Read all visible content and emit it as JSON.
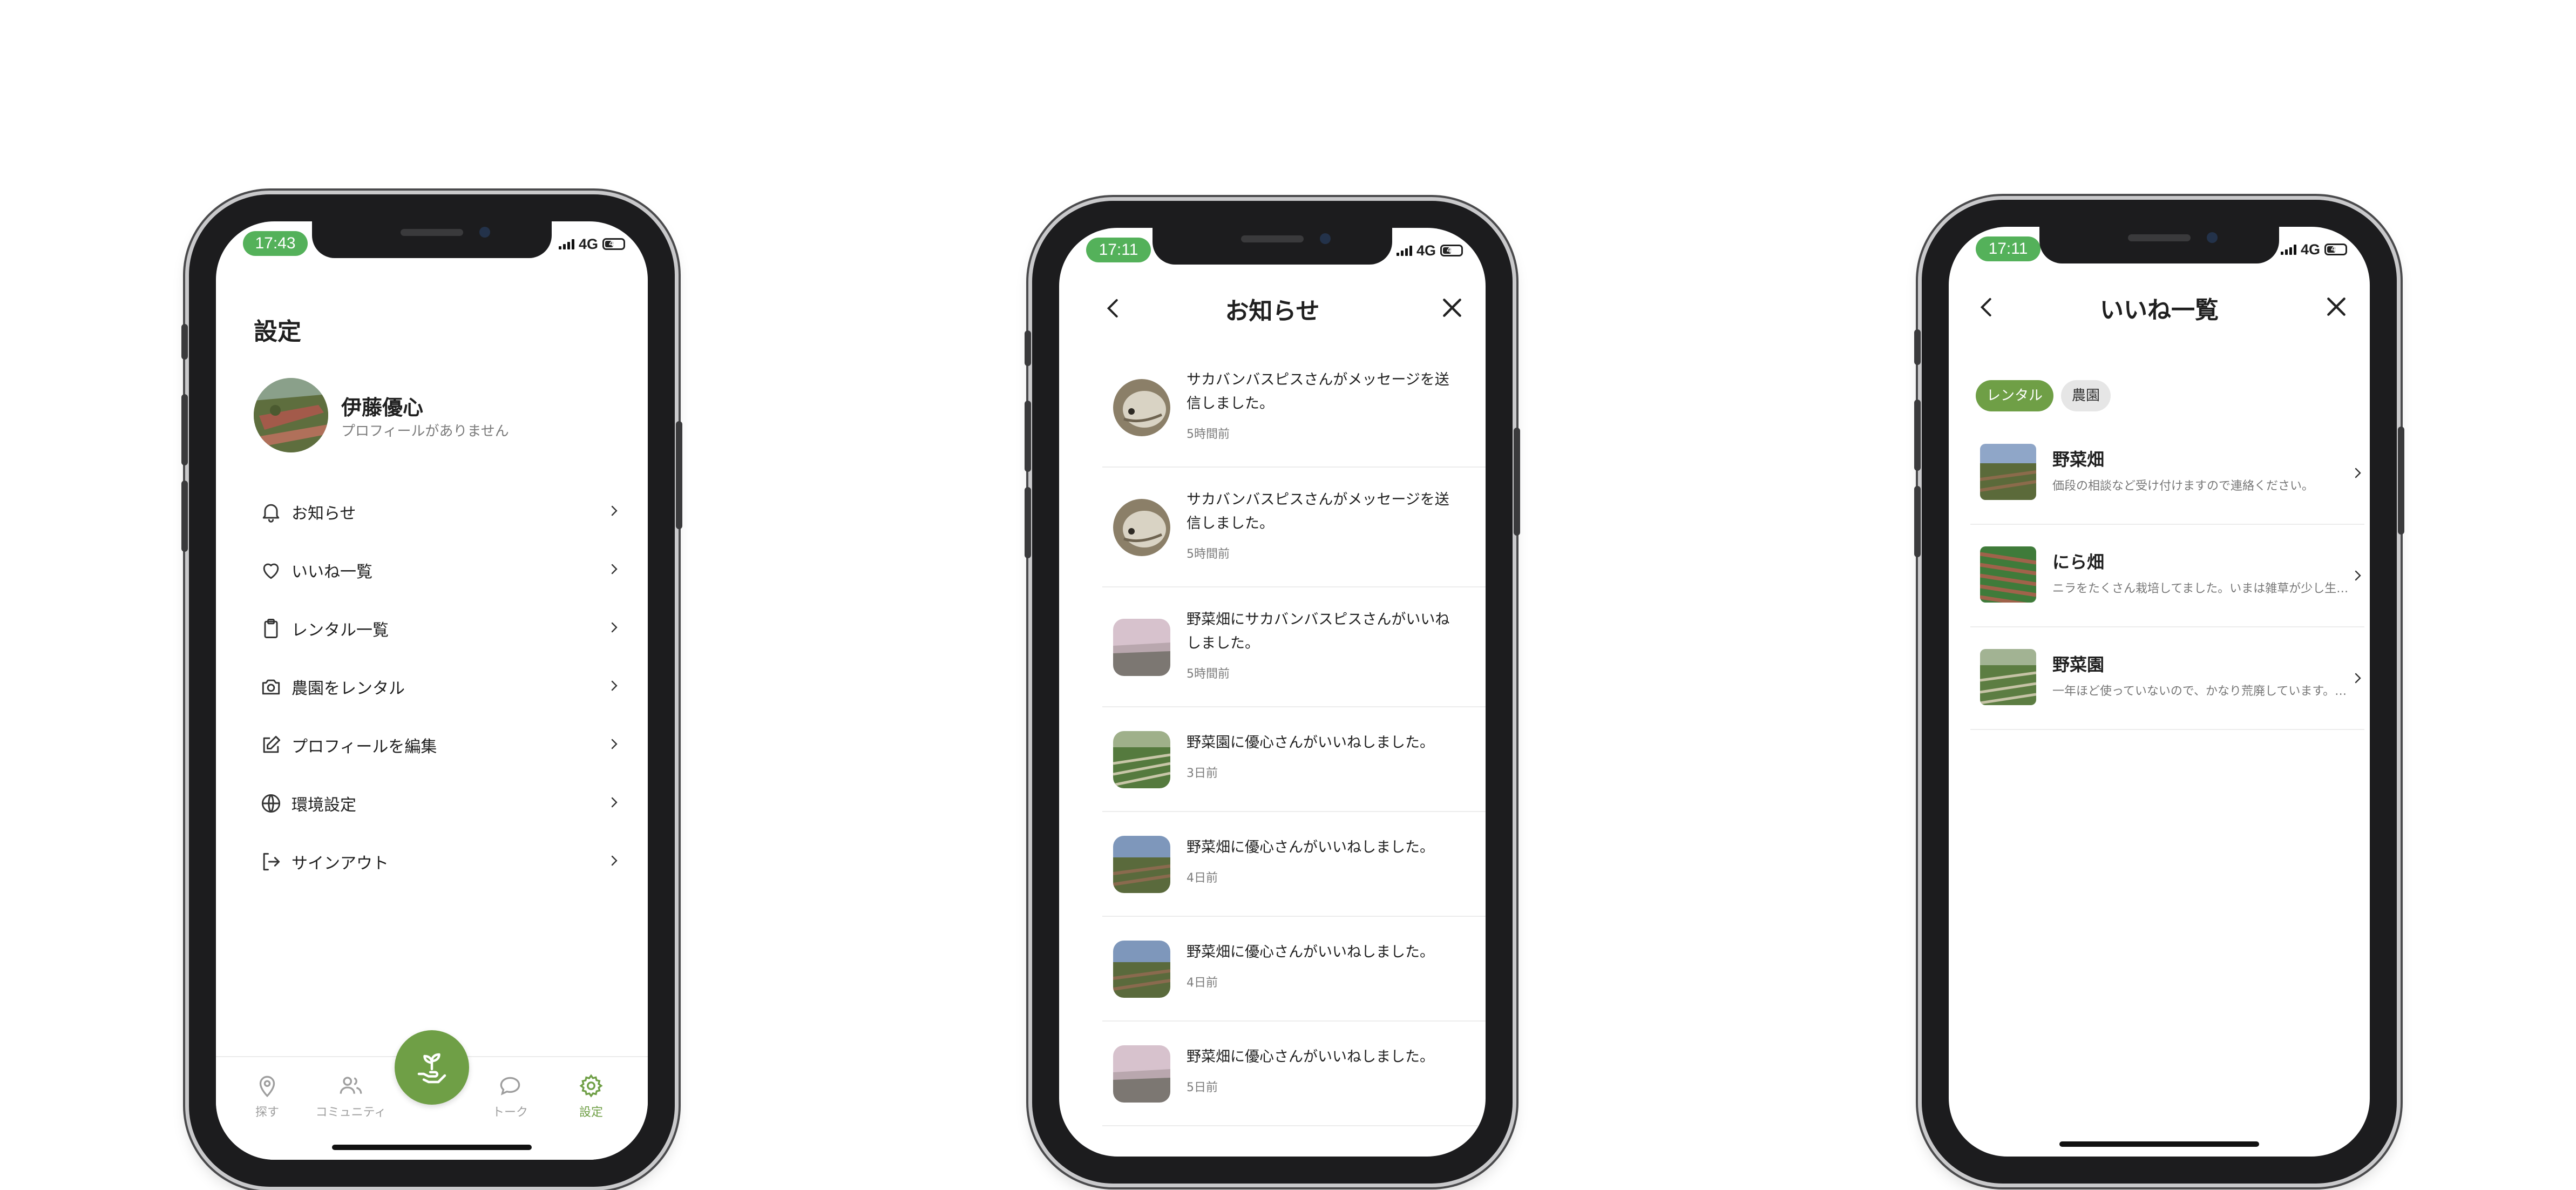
{
  "accent_color": "#6f9f46",
  "status_time_color": "#54b15a",
  "phones": {
    "settings": {
      "status": {
        "time": "17:43",
        "network": "4G",
        "battery": "42"
      },
      "title": "設定",
      "profile": {
        "name": "伊藤優心",
        "subtitle": "プロフィールがありません"
      },
      "menu": [
        {
          "icon": "bell-icon",
          "label": "お知らせ"
        },
        {
          "icon": "heart-icon",
          "label": "いいね一覧"
        },
        {
          "icon": "clipboard-icon",
          "label": "レンタル一覧"
        },
        {
          "icon": "camera-icon",
          "label": "農園をレンタル"
        },
        {
          "icon": "edit-icon",
          "label": "プロフィールを編集"
        },
        {
          "icon": "globe-icon",
          "label": "環境設定"
        },
        {
          "icon": "sign-out-icon",
          "label": "サインアウト"
        }
      ],
      "tabs": [
        {
          "icon": "map-pin-icon",
          "label": "探す",
          "active": false
        },
        {
          "icon": "users-icon",
          "label": "コミュニティ",
          "active": false
        },
        {
          "icon": "chat-icon",
          "label": "トーク",
          "active": false
        },
        {
          "icon": "gear-icon",
          "label": "設定",
          "active": true
        }
      ],
      "fab_icon": "plant-hand-icon"
    },
    "notifications": {
      "status": {
        "time": "17:11",
        "network": "4G",
        "battery": "43"
      },
      "title": "お知らせ",
      "items": [
        {
          "text": "サカバンバスピスさんがメッセージを送信しました。",
          "when": "5時間前",
          "thumb": "fish-avatar"
        },
        {
          "text": "サカバンバスピスさんがメッセージを送信しました。",
          "when": "5時間前",
          "thumb": "fish-avatar"
        },
        {
          "text": "野菜畑にサカバンバスピスさんがいいねしました。",
          "when": "5時間前",
          "thumb": "field-photo"
        },
        {
          "text": "野菜園に優心さんがいいねしました。",
          "when": "3日前",
          "thumb": "field-photo"
        },
        {
          "text": "野菜畑に優心さんがいいねしました。",
          "when": "4日前",
          "thumb": "field-photo"
        },
        {
          "text": "野菜畑に優心さんがいいねしました。",
          "when": "4日前",
          "thumb": "field-photo"
        },
        {
          "text": "野菜畑に優心さんがいいねしました。",
          "when": "5日前",
          "thumb": "field-photo"
        }
      ]
    },
    "likes": {
      "status": {
        "time": "17:11",
        "network": "4G",
        "battery": "43"
      },
      "title": "いいね一覧",
      "chips": [
        {
          "label": "レンタル",
          "active": true
        },
        {
          "label": "農園",
          "active": false
        }
      ],
      "items": [
        {
          "title": "野菜畑",
          "desc": "価段の相談など受け付けますので連絡ください。"
        },
        {
          "title": "にら畑",
          "desc": "ニラをたくさん栽培してました。いまは雑草が少し生えています。"
        },
        {
          "title": "野菜園",
          "desc": "一年ほど使っていないので、かなり荒廃しています。手入れが必要です。"
        }
      ]
    }
  }
}
